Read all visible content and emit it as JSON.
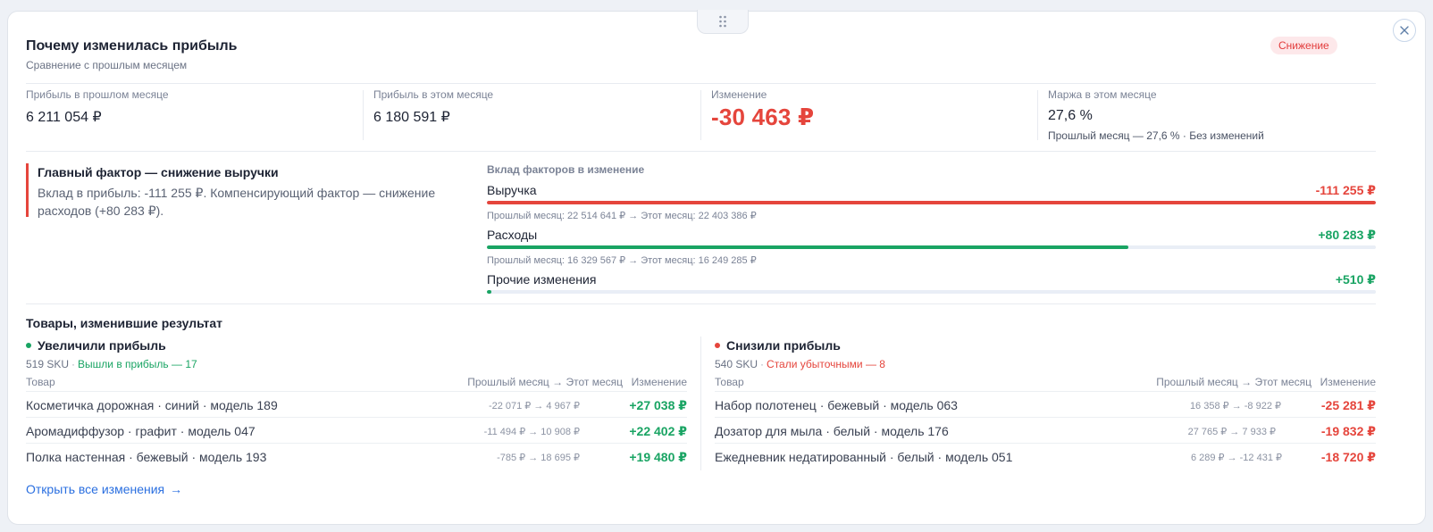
{
  "header": {
    "title": "Почему изменилась прибыль",
    "subtitle": "Сравнение с прошлым месяцем",
    "badge": "Снижение",
    "drag_icon": "drag-handle-icon",
    "close_icon": "close-icon"
  },
  "kpis": [
    {
      "label": "Прибыль в прошлом месяце",
      "value": "6 211 054 ₽"
    },
    {
      "label": "Прибыль в этом месяце",
      "value": "6 180 591 ₽"
    },
    {
      "label": "Изменение",
      "value": "-30 463 ₽"
    },
    {
      "label": "Маржа в этом месяце",
      "value": "27,6 %",
      "note": "Прошлый месяц — 27,6 % · Без изменений"
    }
  ],
  "main_factor": {
    "title": "Главный фактор — снижение выручки",
    "text": "Вклад в прибыль: -111 255 ₽. Компенсирующий фактор — снижение расходов (+80 283 ₽)."
  },
  "contributions": {
    "title": "Вклад факторов в изменение",
    "items": [
      {
        "name": "Выручка",
        "value": "-111 255 ₽",
        "share": 1.0,
        "color": "#e5453c",
        "sub": "Прошлый месяц: 22 514 641 ₽ → Этот месяц: 22 403 386 ₽"
      },
      {
        "name": "Расходы",
        "value": "+80 283 ₽",
        "share": 0.7216,
        "color": "#19a463",
        "sub": "Прошлый месяц: 16 329 567 ₽ → Этот месяц: 16 249 285 ₽"
      },
      {
        "name": "Прочие изменения",
        "value": "+510 ₽",
        "share": 0.0046,
        "color": "#19a463",
        "sub": ""
      }
    ]
  },
  "products": {
    "title": "Товары, изменившие результат",
    "increased": {
      "title": "Увеличили прибыль",
      "count": "519 SKU",
      "extra": "Вышли в прибыль — 17",
      "col_product": "Товар",
      "col_trend": "Прошлый месяц → Этот месяц",
      "col_change": "Изменение",
      "rows": [
        {
          "name": "Косметичка дорожная · синий · модель 189",
          "trend": "-22 071 ₽ → 4 967 ₽",
          "change": "+27 038 ₽"
        },
        {
          "name": "Аромадиффузор · графит · модель 047",
          "trend": "-11 494 ₽ → 10 908 ₽",
          "change": "+22 402 ₽"
        },
        {
          "name": "Полка настенная · бежевый · модель 193",
          "trend": "-785 ₽ → 18 695 ₽",
          "change": "+19 480 ₽"
        }
      ]
    },
    "decreased": {
      "title": "Снизили прибыль",
      "count": "540 SKU",
      "extra": "Стали убыточными — 8",
      "col_product": "Товар",
      "col_trend": "Прошлый месяц → Этот месяц",
      "col_change": "Изменение",
      "rows": [
        {
          "name": "Набор полотенец · бежевый · модель 063",
          "trend": "16 358 ₽ → -8 922 ₽",
          "change": "-25 281 ₽"
        },
        {
          "name": "Дозатор для мыла · белый · модель 176",
          "trend": "27 765 ₽ → 7 933 ₽",
          "change": "-19 832 ₽"
        },
        {
          "name": "Ежедневник недатированный · белый · модель 051",
          "trend": "6 289 ₽ → -12 431 ₽",
          "change": "-18 720 ₽"
        }
      ]
    }
  },
  "footer": {
    "open_all": "Открыть все изменения",
    "arrow": "→"
  },
  "colors": {
    "negative": "#e5453c",
    "positive": "#19a463",
    "accent": "#2a6fe0"
  }
}
